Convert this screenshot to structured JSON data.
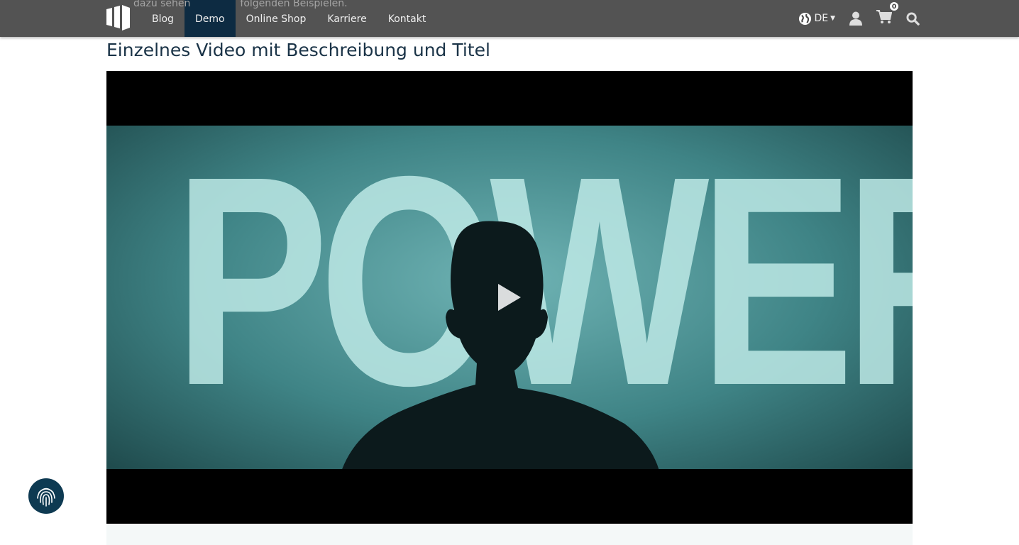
{
  "background_text": {
    "fragment_1": "dazu sehen",
    "fragment_2": "folgenden Beispielen."
  },
  "nav": {
    "items": [
      {
        "label": "Blog"
      },
      {
        "label": "Demo",
        "active": true
      },
      {
        "label": "Online Shop"
      },
      {
        "label": "Karriere"
      },
      {
        "label": "Kontakt"
      }
    ],
    "language": "DE",
    "cart_count": "0"
  },
  "page": {
    "title": "Einzelnes Video mit Beschreibung und Titel"
  },
  "video": {
    "thumbnail_text": "POWER",
    "state": "paused"
  },
  "colors": {
    "nav_bg": "#464646",
    "active_nav": "#0d2b42",
    "title": "#1a3347",
    "consent_button": "#0e3a52"
  }
}
